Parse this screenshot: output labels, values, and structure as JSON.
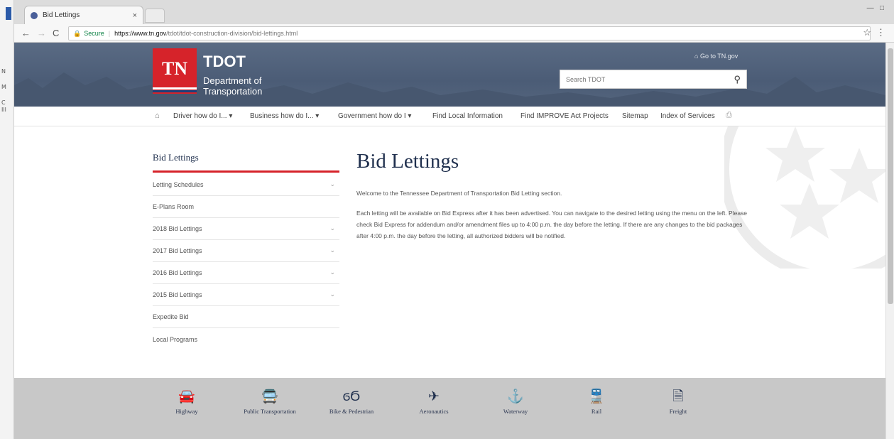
{
  "browser": {
    "tab_title": "Bid Lettings",
    "tab_close": "×",
    "secure_label": "Secure",
    "url_host": "https://www.tn.gov",
    "url_path": "/tdot/tdot-construction-division/bid-lettings.html",
    "left_strip": [
      "N",
      "M",
      "C",
      "Ill"
    ]
  },
  "header": {
    "logo_tn": "TN",
    "logo_title": "TDOT",
    "logo_sub_1": "Department of",
    "logo_sub_2": "Transportation",
    "goto_link": "Go to TN.gov",
    "search_placeholder": "Search TDOT"
  },
  "nav": {
    "items": [
      "Driver how do I... ▾",
      "Business how do I... ▾",
      "Government how do I ▾",
      "Find Local Information",
      "Find IMPROVE Act Projects",
      "Sitemap",
      "Index of Services"
    ]
  },
  "sidebar": {
    "title": "Bid Lettings",
    "items": [
      {
        "label": "Letting Schedules",
        "chevron": "⌄"
      },
      {
        "label": "E-Plans Room",
        "chevron": ""
      },
      {
        "label": "2018 Bid Lettings",
        "chevron": "⌄"
      },
      {
        "label": "2017 Bid Lettings",
        "chevron": "⌄"
      },
      {
        "label": "2016 Bid Lettings",
        "chevron": "⌄"
      },
      {
        "label": "2015 Bid Lettings",
        "chevron": "⌄"
      },
      {
        "label": "Expedite Bid",
        "chevron": ""
      },
      {
        "label": "Local Programs",
        "chevron": ""
      }
    ]
  },
  "main": {
    "title": "Bid Lettings",
    "intro": "Welcome to the Tennessee Department of Transportation Bid Letting section.",
    "body": "Each letting will be available on Bid Express after it has been advertised. You can navigate to the desired letting using the menu on the left. Please check Bid Express for addendum and/or amendment files up to 4:00 p.m. the day before the letting. If there are any changes to the bid packages after 4:00 p.m. the day before the letting, all authorized bidders will be notified."
  },
  "footer": {
    "modes": [
      {
        "icon": "car-icon",
        "glyph": "🚘",
        "label": "Highway"
      },
      {
        "icon": "bus-icon",
        "glyph": "🚍",
        "label": "Public Transportation"
      },
      {
        "icon": "bike-icon",
        "glyph": "ϭϬ",
        "label": "Bike & Pedestrian"
      },
      {
        "icon": "plane-icon",
        "glyph": "✈",
        "label": "Aeronautics"
      },
      {
        "icon": "anchor-icon",
        "glyph": "⚓",
        "label": "Waterway"
      },
      {
        "icon": "train-icon",
        "glyph": "🚆",
        "label": "Rail"
      },
      {
        "icon": "truck-icon",
        "glyph": "🗎",
        "label": "Freight"
      }
    ]
  },
  "colors": {
    "header_bg": "#54657d",
    "logo_red": "#d6232a",
    "title_navy": "#1f2f4d",
    "footer_bg": "#c8c8c8"
  }
}
